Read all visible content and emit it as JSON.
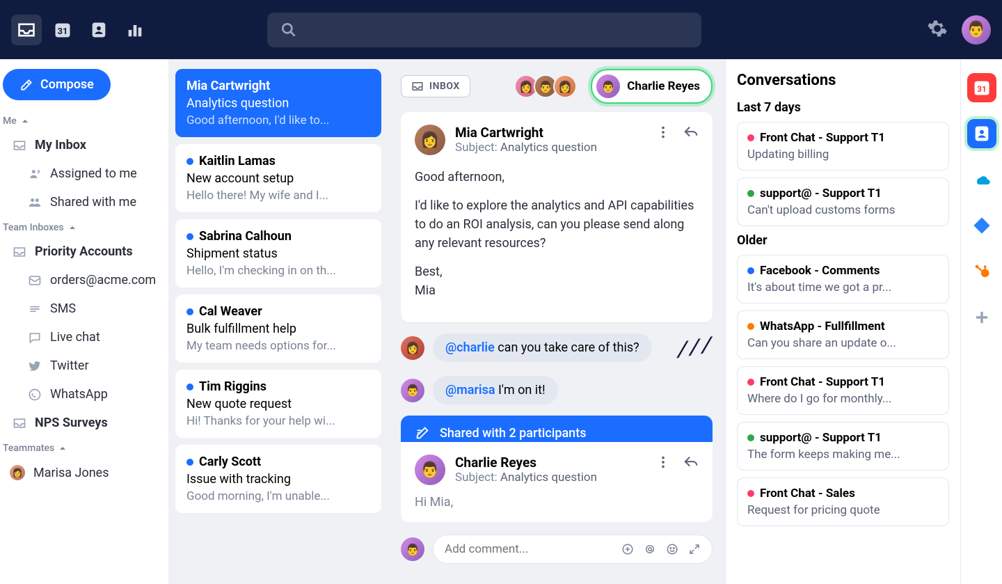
{
  "compose_label": "Compose",
  "sidebar": {
    "sections": {
      "me_label": "Me",
      "my_inbox": "My Inbox",
      "assigned": "Assigned to me",
      "shared": "Shared with me",
      "team_label": "Team Inboxes",
      "priority": "Priority Accounts",
      "orders": "orders@acme.com",
      "sms": "SMS",
      "livechat": "Live chat",
      "twitter": "Twitter",
      "whatsapp": "WhatsApp",
      "nps": "NPS Surveys",
      "teammates_label": "Teammates",
      "teammate1": "Marisa Jones"
    }
  },
  "conversations": [
    {
      "name": "Mia Cartwright",
      "subject": "Analytics question",
      "preview": "Good afternoon, I'd like to...",
      "selected": true
    },
    {
      "name": "Kaitlin Lamas",
      "subject": "New account setup",
      "preview": "Hello there! My wife and I..."
    },
    {
      "name": "Sabrina Calhoun",
      "subject": "Shipment status",
      "preview": "Hello, I'm checking in on th..."
    },
    {
      "name": "Cal Weaver",
      "subject": "Bulk fulfillment help",
      "preview": "My team needs options for..."
    },
    {
      "name": "Tim Riggins",
      "subject": "New quote request",
      "preview": "Hi! Thanks for your help wi..."
    },
    {
      "name": "Carly Scott",
      "subject": "Issue with tracking",
      "preview": "Good morning, I'm unable..."
    }
  ],
  "thread": {
    "inbox_label": "INBOX",
    "assignee": "Charlie Reyes",
    "message": {
      "from": "Mia Cartwright",
      "subject_label": "Subject:",
      "subject": "Analytics question",
      "body_p1": "Good afternoon,",
      "body_p2": "I'd like to explore the analytics and API capabilities to do an ROI analysis, can you please send along any relevant resources?",
      "body_p3": "Best,",
      "body_p4": "Mia"
    },
    "comments": [
      {
        "mention": "@charlie",
        "text": " can you take care of this?"
      },
      {
        "mention": "@marisa",
        "text": " I'm on it!"
      }
    ],
    "shared_banner": "Shared with 2 participants",
    "reply": {
      "from": "Charlie Reyes",
      "subject_label": "Subject:",
      "subject": "Analytics question",
      "preview": "Hi Mia,"
    },
    "comment_placeholder": "Add comment..."
  },
  "rightpanel": {
    "title": "Conversations",
    "section1": "Last 7 days",
    "section2": "Older",
    "items1": [
      {
        "dot": "#ff3b6b",
        "title": "Front Chat - Support T1",
        "desc": "Updating billing"
      },
      {
        "dot": "#2aa84a",
        "title": "support@ - Support T1",
        "desc": "Can't upload customs forms"
      }
    ],
    "items2": [
      {
        "dot": "#1a6dff",
        "title": "Facebook - Comments",
        "desc": "It's about time we got a pr..."
      },
      {
        "dot": "#ff7a00",
        "title": "WhatsApp - Fullfillment",
        "desc": "Can you share an update o..."
      },
      {
        "dot": "#ff3b6b",
        "title": "Front Chat - Support T1",
        "desc": "Where do I go for monthly..."
      },
      {
        "dot": "#2aa84a",
        "title": "support@ - Support T1",
        "desc": "The form keeps making me..."
      },
      {
        "dot": "#ff3b6b",
        "title": "Front Chat - Sales",
        "desc": "Request for pricing quote"
      }
    ]
  }
}
